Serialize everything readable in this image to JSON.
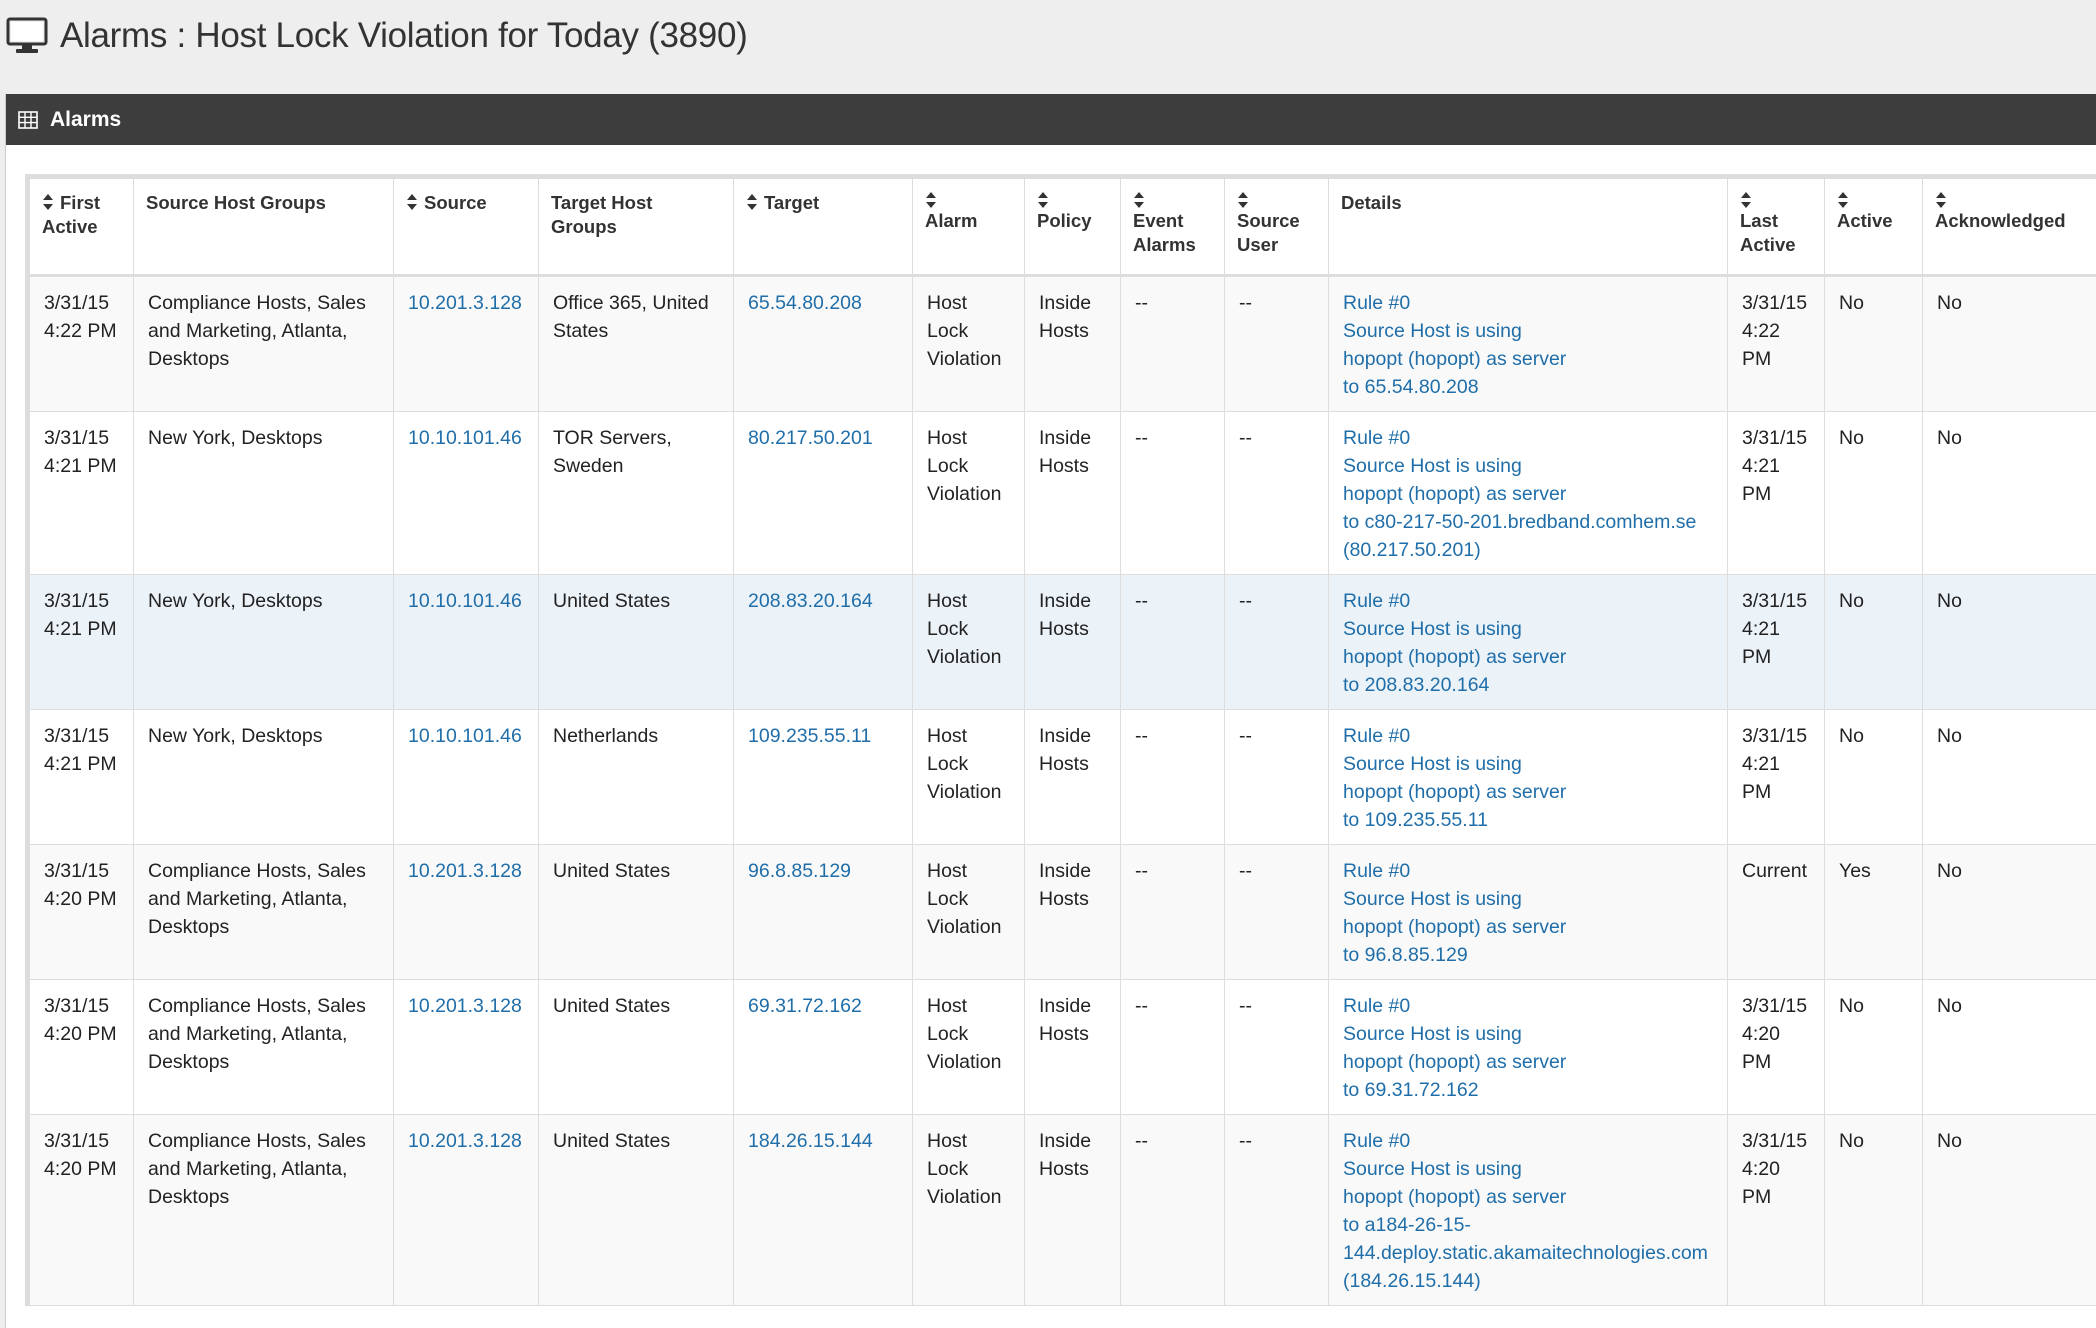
{
  "header": {
    "title": "Alarms : Host Lock Violation for Today (3890)"
  },
  "panel": {
    "title": "Alarms"
  },
  "columns": [
    {
      "key": "first_active",
      "label": "First Active",
      "sortable": true
    },
    {
      "key": "source_host_groups",
      "label": "Source Host Groups",
      "sortable": false
    },
    {
      "key": "source",
      "label": "Source",
      "sortable": true
    },
    {
      "key": "target_host_groups",
      "label": "Target Host Groups",
      "sortable": false
    },
    {
      "key": "target",
      "label": "Target",
      "sortable": true
    },
    {
      "key": "alarm",
      "label": "Alarm",
      "sortable": true
    },
    {
      "key": "policy",
      "label": "Policy",
      "sortable": true
    },
    {
      "key": "event_alarms",
      "label": "Event Alarms",
      "sortable": true
    },
    {
      "key": "source_user",
      "label": "Source User",
      "sortable": true
    },
    {
      "key": "details",
      "label": "Details",
      "sortable": false
    },
    {
      "key": "last_active",
      "label": "Last Active",
      "sortable": true
    },
    {
      "key": "active",
      "label": "Active",
      "sortable": true
    },
    {
      "key": "acknowledged",
      "label": "Acknowledged",
      "sortable": true
    }
  ],
  "rows": [
    {
      "first_active": [
        "3/31/15",
        "4:22 PM"
      ],
      "source_host_groups": [
        "Compliance Hosts, Sales",
        "and Marketing, Atlanta,",
        "Desktops"
      ],
      "source": "10.201.3.128",
      "target_host_groups": [
        "Office 365, United",
        "States"
      ],
      "target": "65.54.80.208",
      "alarm": [
        "Host",
        "Lock",
        "Violation"
      ],
      "policy": [
        "Inside",
        "Hosts"
      ],
      "event_alarms": "--",
      "source_user": "--",
      "details": [
        "Rule #0",
        "Source Host is using",
        "hopopt (hopopt) as server",
        "to 65.54.80.208"
      ],
      "last_active": [
        "3/31/15",
        "4:22",
        "PM"
      ],
      "active": "No",
      "acknowledged": "No"
    },
    {
      "first_active": [
        "3/31/15",
        "4:21 PM"
      ],
      "source_host_groups": [
        "New York, Desktops"
      ],
      "source": "10.10.101.46",
      "target_host_groups": [
        "TOR Servers,",
        "Sweden"
      ],
      "target": "80.217.50.201",
      "alarm": [
        "Host",
        "Lock",
        "Violation"
      ],
      "policy": [
        "Inside",
        "Hosts"
      ],
      "event_alarms": "--",
      "source_user": "--",
      "details": [
        "Rule #0",
        "Source Host is using",
        "hopopt (hopopt) as server",
        "to c80-217-50-201.bredband.comhem.se",
        "(80.217.50.201)"
      ],
      "last_active": [
        "3/31/15",
        "4:21",
        "PM"
      ],
      "active": "No",
      "acknowledged": "No"
    },
    {
      "first_active": [
        "3/31/15",
        "4:21 PM"
      ],
      "source_host_groups": [
        "New York, Desktops"
      ],
      "source": "10.10.101.46",
      "target_host_groups": [
        "United States"
      ],
      "target": "208.83.20.164",
      "alarm": [
        "Host",
        "Lock",
        "Violation"
      ],
      "policy": [
        "Inside",
        "Hosts"
      ],
      "event_alarms": "--",
      "source_user": "--",
      "details": [
        "Rule #0",
        "Source Host is using",
        "hopopt (hopopt) as server",
        "to 208.83.20.164"
      ],
      "last_active": [
        "3/31/15",
        "4:21",
        "PM"
      ],
      "active": "No",
      "acknowledged": "No"
    },
    {
      "first_active": [
        "3/31/15",
        "4:21 PM"
      ],
      "source_host_groups": [
        "New York, Desktops"
      ],
      "source": "10.10.101.46",
      "target_host_groups": [
        "Netherlands"
      ],
      "target": "109.235.55.11",
      "alarm": [
        "Host",
        "Lock",
        "Violation"
      ],
      "policy": [
        "Inside",
        "Hosts"
      ],
      "event_alarms": "--",
      "source_user": "--",
      "details": [
        "Rule #0",
        "Source Host is using",
        "hopopt (hopopt) as server",
        "to 109.235.55.11"
      ],
      "last_active": [
        "3/31/15",
        "4:21",
        "PM"
      ],
      "active": "No",
      "acknowledged": "No"
    },
    {
      "first_active": [
        "3/31/15",
        "4:20 PM"
      ],
      "source_host_groups": [
        "Compliance Hosts, Sales",
        "and Marketing, Atlanta,",
        "Desktops"
      ],
      "source": "10.201.3.128",
      "target_host_groups": [
        "United States"
      ],
      "target": "96.8.85.129",
      "alarm": [
        "Host",
        "Lock",
        "Violation"
      ],
      "policy": [
        "Inside",
        "Hosts"
      ],
      "event_alarms": "--",
      "source_user": "--",
      "details": [
        "Rule #0",
        "Source Host is using",
        "hopopt (hopopt) as server",
        "to 96.8.85.129"
      ],
      "last_active": [
        "Current"
      ],
      "active": "Yes",
      "acknowledged": "No"
    },
    {
      "first_active": [
        "3/31/15",
        "4:20 PM"
      ],
      "source_host_groups": [
        "Compliance Hosts, Sales",
        "and Marketing, Atlanta,",
        "Desktops"
      ],
      "source": "10.201.3.128",
      "target_host_groups": [
        "United States"
      ],
      "target": "69.31.72.162",
      "alarm": [
        "Host",
        "Lock",
        "Violation"
      ],
      "policy": [
        "Inside",
        "Hosts"
      ],
      "event_alarms": "--",
      "source_user": "--",
      "details": [
        "Rule #0",
        "Source Host is using",
        "hopopt (hopopt) as server",
        "to 69.31.72.162"
      ],
      "last_active": [
        "3/31/15",
        "4:20",
        "PM"
      ],
      "active": "No",
      "acknowledged": "No"
    },
    {
      "first_active": [
        "3/31/15",
        "4:20 PM"
      ],
      "source_host_groups": [
        "Compliance Hosts, Sales",
        "and Marketing, Atlanta,",
        "Desktops"
      ],
      "source": "10.201.3.128",
      "target_host_groups": [
        "United States"
      ],
      "target": "184.26.15.144",
      "alarm": [
        "Host",
        "Lock",
        "Violation"
      ],
      "policy": [
        "Inside",
        "Hosts"
      ],
      "event_alarms": "--",
      "source_user": "--",
      "details": [
        "Rule #0",
        "Source Host is using",
        "hopopt (hopopt) as server",
        "to a184-26-15-",
        "144.deploy.static.akamaitechnologies.com",
        "(184.26.15.144)"
      ],
      "last_active": [
        "3/31/15",
        "4:20",
        "PM"
      ],
      "active": "No",
      "acknowledged": "No"
    }
  ],
  "colors": {
    "link": "#1f6ea9",
    "panel_header": "#3d3d3d",
    "row_highlight": "#ebf2f8",
    "row_striped": "#f9f9f9"
  },
  "icons": {
    "header": "monitor-icon",
    "panel": "table-grid-icon",
    "sort": "sort-icon"
  }
}
